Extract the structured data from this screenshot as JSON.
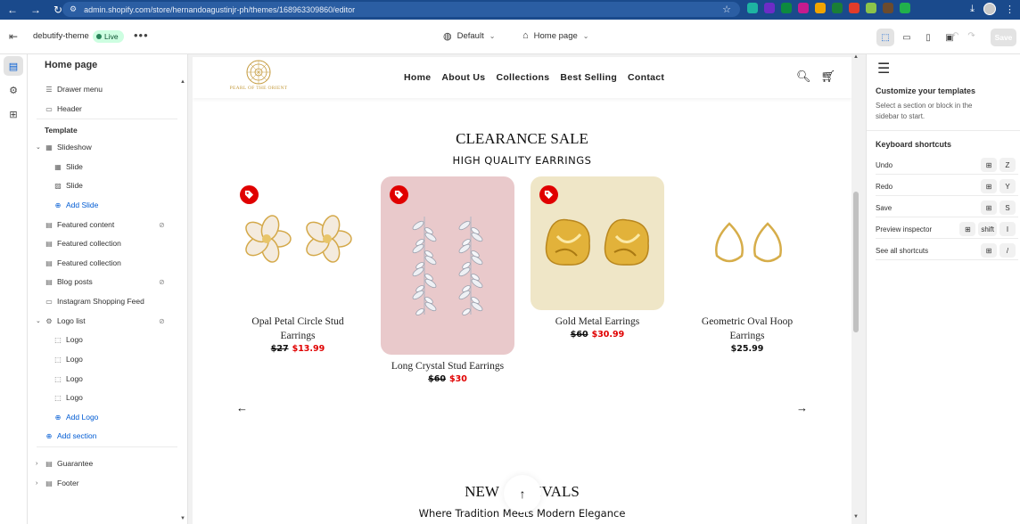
{
  "browser": {
    "url": "admin.shopify.com/store/hernandoagustinjr-ph/themes/168963309860/editor",
    "extensions": [
      {
        "name": "grammar-ext-icon",
        "color": "#1eb4a2"
      },
      {
        "name": "download-ext-icon",
        "color": "#6d2cc6"
      },
      {
        "name": "leaf-ext-icon",
        "color": "#0d8a3f"
      },
      {
        "name": "circle-ext-icon",
        "color": "#c61b8e"
      },
      {
        "name": "flag-ext-icon",
        "color": "#f0a400"
      },
      {
        "name": "m-ext-icon",
        "color": "#1a7f37"
      },
      {
        "name": "color-ext-icon",
        "color": "#e23c2a"
      },
      {
        "name": "badge-ext-icon",
        "color": "#8bc34a"
      },
      {
        "name": "dot-ext-icon",
        "color": "#6b4b2e"
      },
      {
        "name": "grid-ext-icon",
        "color": "#21b14c"
      }
    ]
  },
  "topbar": {
    "theme_name": "debutify-theme",
    "live_label": "Live",
    "more_label": "•••",
    "template_select": "Default",
    "page_select": "Home page",
    "save_label": "Save"
  },
  "sidebar": {
    "title": "Home page",
    "header_items": [
      {
        "label": "Drawer menu"
      },
      {
        "label": "Header"
      }
    ],
    "template_heading": "Template",
    "slideshow": {
      "label": "Slideshow",
      "children": [
        {
          "label": "Slide"
        },
        {
          "label": "Slide"
        }
      ],
      "add_label": "Add Slide"
    },
    "sections": [
      {
        "label": "Featured content",
        "hidden": true
      },
      {
        "label": "Featured collection",
        "hidden": false
      },
      {
        "label": "Featured collection",
        "hidden": false
      },
      {
        "label": "Blog posts",
        "hidden": true
      },
      {
        "label": "Instagram Shopping Feed",
        "hidden": false
      }
    ],
    "logo_list": {
      "label": "Logo list",
      "hidden": true,
      "children": [
        {
          "label": "Logo"
        },
        {
          "label": "Logo"
        },
        {
          "label": "Logo"
        },
        {
          "label": "Logo"
        }
      ],
      "add_label": "Add Logo"
    },
    "add_section_label": "Add section",
    "footer_items": [
      {
        "label": "Guarantee"
      },
      {
        "label": "Footer"
      }
    ]
  },
  "store": {
    "logo_text": "PEARL OF THE ORIENT",
    "menu": [
      "Home",
      "About Us",
      "Collections",
      "Best Selling",
      "Contact"
    ],
    "section_title": "CLEARANCE SALE",
    "section_subtitle": "HIGH QUALITY EARRINGS",
    "products": [
      {
        "name": "Opal Petal Circle Stud Earrings",
        "old_price": "$27",
        "price": "$13.99",
        "sale": true,
        "bg": "#ffffff"
      },
      {
        "name": "Long Crystal Stud Earrings",
        "old_price": "$60",
        "price": "$30",
        "sale": true,
        "bg": "#e9c9cb"
      },
      {
        "name": "Gold Metal Earrings",
        "old_price": "$60",
        "price": "$30.99",
        "sale": true,
        "bg": "#efe6c7"
      },
      {
        "name": "Geometric Oval Hoop Earrings",
        "old_price": "",
        "price": "$25.99",
        "sale": false,
        "bg": "#ffffff"
      }
    ],
    "next_section_title_left": "NEW",
    "next_section_title_right": "IVALS",
    "next_section_subtitle": "Where Tradition Meets Modern Elegance"
  },
  "right_panel": {
    "heading": "Customize your templates",
    "text": "Select a section or block in the sidebar to start.",
    "shortcuts_heading": "Keyboard shortcuts",
    "shortcuts": [
      {
        "label": "Undo",
        "keys": [
          "⊞",
          "Z"
        ]
      },
      {
        "label": "Redo",
        "keys": [
          "⊞",
          "Y"
        ]
      },
      {
        "label": "Save",
        "keys": [
          "⊞",
          "S"
        ]
      },
      {
        "label": "Preview inspector",
        "keys": [
          "⊞",
          "shift",
          "I"
        ]
      },
      {
        "label": "See all shortcuts",
        "keys": [
          "⊞",
          "/"
        ]
      }
    ]
  },
  "colors": {
    "accent": "#005bd3",
    "sale_red": "#e00000",
    "browser_bar": "#1a4a8c",
    "logo_gold": "#c49a3c"
  }
}
